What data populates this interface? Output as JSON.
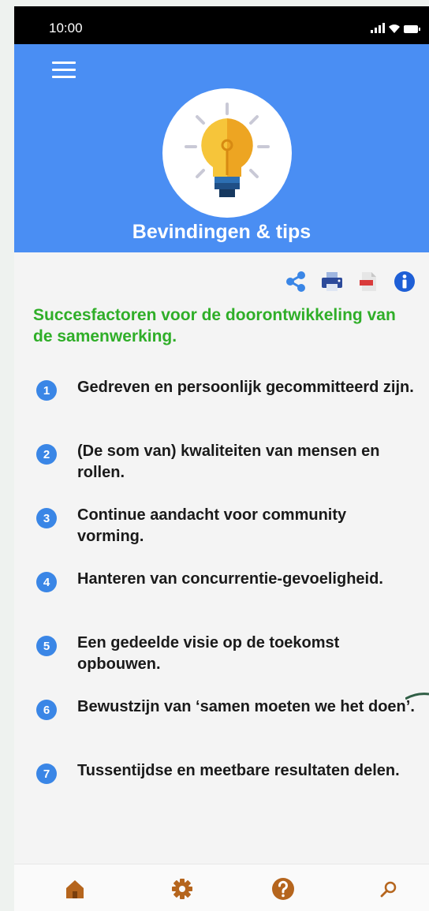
{
  "status": {
    "time": "10:00"
  },
  "header": {
    "title": "Bevindingen & tips"
  },
  "actions": [
    {
      "icon": "share-icon",
      "color": "#3a86e6"
    },
    {
      "icon": "printer-icon",
      "color": "#2c4a9a"
    },
    {
      "icon": "pdf-icon",
      "color": "#d93b3b"
    },
    {
      "icon": "info-icon",
      "color": "#1e5fd6"
    }
  ],
  "section": {
    "title": "Succesfactoren voor de doorontwikkeling van de samenwerking."
  },
  "items": [
    {
      "num": "1",
      "text": "Gedreven en persoonlijk gecommitteerd zijn."
    },
    {
      "num": "2",
      "text": "(De som van) kwaliteiten van mensen en rollen."
    },
    {
      "num": "3",
      "text": "Continue aandacht voor community vorming."
    },
    {
      "num": "4",
      "text": "Hanteren van concurrentie-gevoeligheid."
    },
    {
      "num": "5",
      "text": "Een gedeelde visie op de toekomst opbouwen."
    },
    {
      "num": "6",
      "text": "Bewustzijn van ‘samen moeten we het doen’."
    },
    {
      "num": "7",
      "text": "Tussentijdse en meetbare resultaten delen."
    }
  ],
  "nav": [
    {
      "icon": "home-icon"
    },
    {
      "icon": "settings-gear-icon"
    },
    {
      "icon": "help-icon"
    },
    {
      "icon": "search-icon"
    }
  ],
  "colors": {
    "header": "#4a8ef3",
    "accent_green": "#2fae28",
    "badge": "#3a86e6",
    "nav": "#b5651d"
  }
}
